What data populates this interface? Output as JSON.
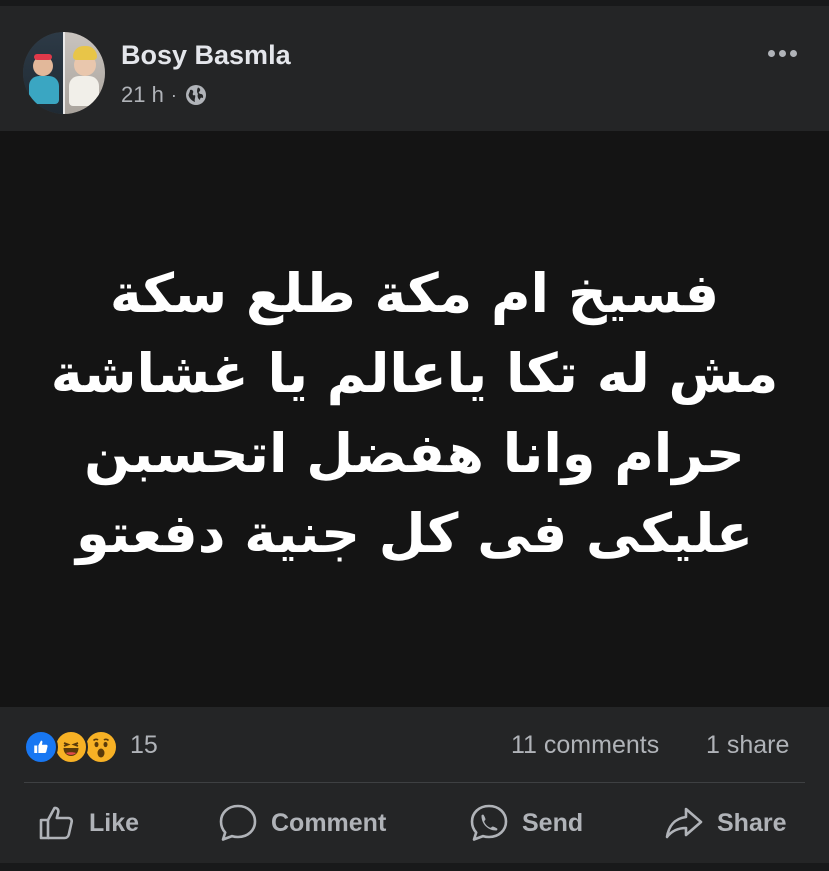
{
  "post": {
    "author": {
      "name": "Bosy Basmla"
    },
    "meta": {
      "time": "21 h",
      "separator": "·",
      "audience_icon": "globe-icon"
    },
    "more_icon": "more-horizontal-icon",
    "content": {
      "background": "#141414",
      "text_color": "#ffffff",
      "lines": [
        "فسيخ ام مكة طلع سكة",
        "مش له تكا ياعالم يا غشاشة",
        "حرام وانا هفضل اتحسبن",
        "عليكى فى كل جنية دفعتو"
      ]
    },
    "reactions": {
      "icons": [
        "like-icon",
        "haha-icon",
        "wow-icon"
      ],
      "count": "15",
      "comments": "11 comments",
      "shares": "1 share"
    },
    "actions": [
      {
        "label": "Like",
        "icon": "thumbs-up-icon"
      },
      {
        "label": "Comment",
        "icon": "comment-bubble-icon"
      },
      {
        "label": "Send",
        "icon": "messenger-icon"
      },
      {
        "label": "Share",
        "icon": "share-arrow-icon"
      }
    ],
    "colors": {
      "surface": "#242526",
      "text_primary": "#e4e6eb",
      "text_secondary": "#b0b3b8",
      "like_blue": "#1877f2",
      "emoji_yellow": "#f7b125"
    }
  }
}
